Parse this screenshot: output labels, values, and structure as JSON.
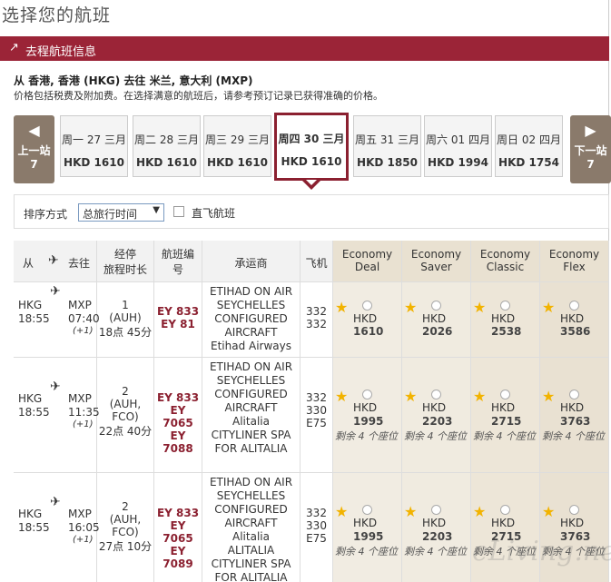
{
  "page": {
    "title": "选择您的航班"
  },
  "section": {
    "title": "去程航班信息"
  },
  "route": "从 香港, 香港 (HKG) 去往 米兰, 意大利 (MXP)",
  "note": "价格包括税费及附加费。在选择满意的航班后，请参考预订记录已获得准确的价格。",
  "nav": {
    "prev_l1": "上一站",
    "prev_l2": "7",
    "next_l1": "下一站",
    "next_l2": "7"
  },
  "days": [
    {
      "date": "周一 27 三月",
      "price": "HKD 1610"
    },
    {
      "date": "周二 28 三月",
      "price": "HKD 1610"
    },
    {
      "date": "周三 29 三月",
      "price": "HKD 1610"
    },
    {
      "date": "周四 30 三月",
      "price": "HKD 1610"
    },
    {
      "date": "周五 31 三月",
      "price": "HKD 1850"
    },
    {
      "date": "周六 01 四月",
      "price": "HKD 1994"
    },
    {
      "date": "周日 02 四月",
      "price": "HKD 1754"
    }
  ],
  "sort": {
    "label": "排序方式",
    "value": "总旅行时间",
    "nonstop_label": "直飞航班"
  },
  "columns": {
    "from": "从",
    "to": "去往",
    "dur1": "经停",
    "dur2": "旅程时长",
    "fno1": "航班编",
    "fno2": "号",
    "carrier": "承运商",
    "aircraft": "飞机",
    "f1a": "Economy",
    "f1b": "Deal",
    "f2a": "Economy",
    "f2b": "Saver",
    "f3a": "Economy",
    "f3b": "Classic",
    "f4a": "Economy",
    "f4b": "Flex"
  },
  "rows": [
    {
      "from": "HKG",
      "dep": "18:55",
      "to": "MXP",
      "arr": "07:40",
      "plus": "(+1)",
      "stops": "1",
      "via": "(AUH)",
      "via2": "",
      "duration": "18点 45分",
      "fn1": "EY 833",
      "fn2": "EY 81",
      "fn3": "",
      "carrier": [
        "ETIHAD ON AIR",
        "SEYCHELLES",
        "CONFIGURED",
        "AIRCRAFT",
        "Etihad Airways",
        "",
        ""
      ],
      "ac": [
        "332",
        "332",
        ""
      ],
      "fares": [
        {
          "cur": "HKD",
          "amt": "1610",
          "seats": ""
        },
        {
          "cur": "HKD",
          "amt": "2026",
          "seats": ""
        },
        {
          "cur": "HKD",
          "amt": "2538",
          "seats": ""
        },
        {
          "cur": "HKD",
          "amt": "3586",
          "seats": ""
        }
      ]
    },
    {
      "from": "HKG",
      "dep": "18:55",
      "to": "MXP",
      "arr": "11:35",
      "plus": "(+1)",
      "stops": "2",
      "via": "(AUH,",
      "via2": "FCO)",
      "duration": "22点 40分",
      "fn1": "EY 833",
      "fn2": "EY 7065",
      "fn3": "EY 7088",
      "carrier": [
        "ETIHAD ON AIR",
        "SEYCHELLES",
        "CONFIGURED",
        "AIRCRAFT",
        "Alitalia",
        "CITYLINER SPA",
        "FOR ALITALIA"
      ],
      "ac": [
        "332",
        "330",
        "E75"
      ],
      "fares": [
        {
          "cur": "HKD",
          "amt": "1995",
          "seats": "剩余 4 个座位"
        },
        {
          "cur": "HKD",
          "amt": "2203",
          "seats": "剩余 4 个座位"
        },
        {
          "cur": "HKD",
          "amt": "2715",
          "seats": "剩余 4 个座位"
        },
        {
          "cur": "HKD",
          "amt": "3763",
          "seats": "剩余 4 个座位"
        }
      ]
    },
    {
      "from": "HKG",
      "dep": "18:55",
      "to": "MXP",
      "arr": "16:05",
      "plus": "(+1)",
      "stops": "2",
      "via": "(AUH,",
      "via2": "FCO)",
      "duration": "27点 10分",
      "fn1": "EY 833",
      "fn2": "EY 7065",
      "fn3": "EY 7089",
      "carrier": [
        "ETIHAD ON AIR",
        "SEYCHELLES",
        "CONFIGURED",
        "AIRCRAFT",
        "Alitalia",
        "ALITALIA",
        "CITYLINER SPA",
        "FOR ALITALIA"
      ],
      "ac": [
        "332",
        "330",
        "E75"
      ],
      "fares": [
        {
          "cur": "HKD",
          "amt": "1995",
          "seats": "剩余 4 个座位"
        },
        {
          "cur": "HKD",
          "amt": "2203",
          "seats": "剩余 4 个座位"
        },
        {
          "cur": "HKD",
          "amt": "2715",
          "seats": "剩余 4 个座位"
        },
        {
          "cur": "HKD",
          "amt": "3763",
          "seats": "剩余 4 个座位"
        }
      ]
    }
  ],
  "watermark": "eLiving.net",
  "colors": {
    "accent": "#9b2437",
    "nav": "#8a7a6b",
    "star": "#f2b300"
  }
}
